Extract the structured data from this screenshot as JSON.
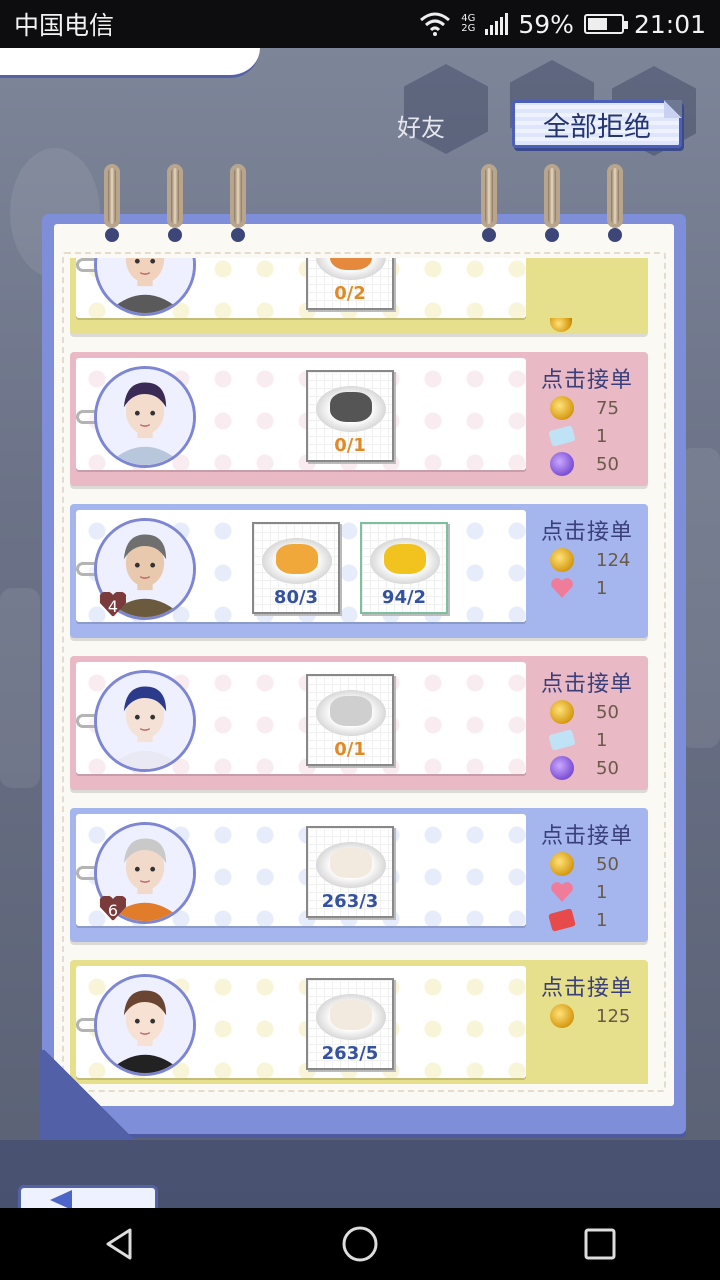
{
  "status_bar": {
    "carrier": "中国电信",
    "network_top": "4G",
    "network_bottom": "2G",
    "battery": "59%",
    "battery_level": 0.59,
    "time": "21:01"
  },
  "scene": {
    "friend_label": "好友"
  },
  "header": {
    "reject_all_label": "全部拒绝"
  },
  "orders": [
    {
      "theme": "yellow",
      "dishes": [
        {
          "count": "0/2",
          "food_color": "#e58a3c",
          "short": true
        }
      ],
      "rewards": [],
      "partial": true
    },
    {
      "theme": "pink",
      "accept_label": "点击接单",
      "dishes": [
        {
          "count": "0/1",
          "food_color": "#555555",
          "short": true
        }
      ],
      "rewards": [
        {
          "icon": "coin-icon",
          "value": "75"
        },
        {
          "icon": "ticket-icon",
          "value": "1"
        },
        {
          "icon": "purple-gem-icon",
          "value": "50"
        }
      ]
    },
    {
      "theme": "blue",
      "accept_label": "点击接单",
      "level": "4",
      "dishes": [
        {
          "count": "80/3",
          "food_color": "#f0a83a",
          "short": false
        },
        {
          "count": "94/2",
          "food_color": "#f2c21e",
          "short": false
        }
      ],
      "rewards": [
        {
          "icon": "coin-icon",
          "value": "124"
        },
        {
          "icon": "heart-icon",
          "value": "1"
        }
      ]
    },
    {
      "theme": "pink",
      "accept_label": "点击接单",
      "dishes": [
        {
          "count": "0/1",
          "food_color": "#cfcfcf",
          "short": true
        }
      ],
      "rewards": [
        {
          "icon": "coin-icon",
          "value": "50"
        },
        {
          "icon": "ticket-icon",
          "value": "1"
        },
        {
          "icon": "purple-gem-icon",
          "value": "50"
        }
      ]
    },
    {
      "theme": "blue",
      "accept_label": "点击接单",
      "level": "6",
      "dishes": [
        {
          "count": "263/3",
          "food_color": "#f3eadf",
          "short": false
        }
      ],
      "rewards": [
        {
          "icon": "coin-icon",
          "value": "50"
        },
        {
          "icon": "heart-icon",
          "value": "1"
        },
        {
          "icon": "red-envelope-icon",
          "value": "1"
        }
      ]
    },
    {
      "theme": "yellow",
      "accept_label": "点击接单",
      "dishes": [
        {
          "count": "263/5",
          "food_color": "#f3eadf",
          "short": false
        }
      ],
      "rewards": [
        {
          "icon": "coin-icon",
          "value": "125"
        }
      ]
    }
  ],
  "nav": {
    "back": "back-icon",
    "home": "home-icon",
    "recents": "recents-icon"
  }
}
